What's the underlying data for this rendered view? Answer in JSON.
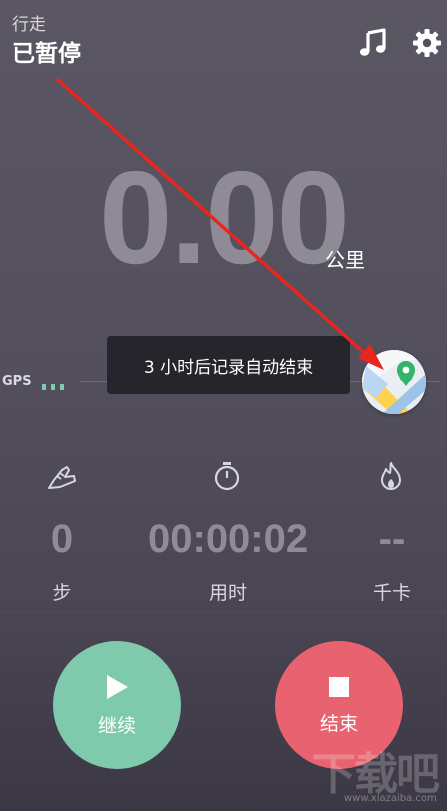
{
  "header": {
    "activity_type": "行走",
    "status": "已暂停",
    "icons": [
      "music-note-icon",
      "gear-icon"
    ]
  },
  "distance": {
    "value": "0.00",
    "unit": "公里"
  },
  "gps": {
    "label": "GPS"
  },
  "toast": {
    "message": "3 小时后记录自动结束"
  },
  "map_button": {
    "icon": "map-location-icon"
  },
  "stats": [
    {
      "icon": "shoe-icon",
      "value": "0",
      "label": "步"
    },
    {
      "icon": "stopwatch-icon",
      "value": "00:00:02",
      "label": "用时"
    },
    {
      "icon": "flame-icon",
      "value": "--",
      "label": "千卡"
    }
  ],
  "buttons": {
    "resume_label": "继续",
    "stop_label": "结束"
  },
  "watermark": {
    "logo": "下载吧",
    "url": "www.xiazaiba.com"
  },
  "colors": {
    "background": "#534f5d",
    "big_number": "#8f8b96",
    "resume": "#7fc9ac",
    "stop": "#e8636f",
    "gps_signal": "#7fc9ac",
    "annotation_arrow": "#e8261e"
  }
}
